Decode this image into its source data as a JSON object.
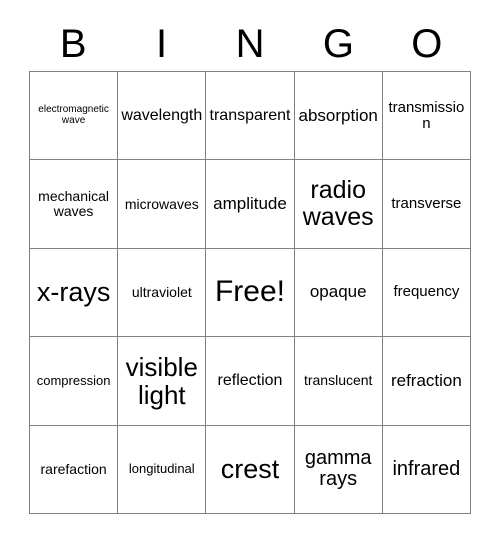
{
  "card": {
    "title_letters": [
      "B",
      "I",
      "N",
      "G",
      "O"
    ],
    "rows": [
      [
        {
          "text": "electromagnetic wave",
          "size": "fs-10"
        },
        {
          "text": "wavelength",
          "size": "fs-16"
        },
        {
          "text": "transparent",
          "size": "fs-16"
        },
        {
          "text": "absorption",
          "size": "fs-17"
        },
        {
          "text": "transmission",
          "size": "fs-15"
        }
      ],
      [
        {
          "text": "mechanical waves",
          "size": "fs-14"
        },
        {
          "text": "microwaves",
          "size": "fs-14"
        },
        {
          "text": "amplitude",
          "size": "fs-17"
        },
        {
          "text": "radio waves",
          "size": "fs-25"
        },
        {
          "text": "transverse",
          "size": "fs-15"
        }
      ],
      [
        {
          "text": "x-rays",
          "size": "fs-27"
        },
        {
          "text": "ultraviolet",
          "size": "fs-14"
        },
        {
          "text": "Free!",
          "size": "fs-30"
        },
        {
          "text": "opaque",
          "size": "fs-17"
        },
        {
          "text": "frequency",
          "size": "fs-15"
        }
      ],
      [
        {
          "text": "compression",
          "size": "fs-13"
        },
        {
          "text": "visible light",
          "size": "fs-26"
        },
        {
          "text": "reflection",
          "size": "fs-16"
        },
        {
          "text": "translucent",
          "size": "fs-14"
        },
        {
          "text": "refraction",
          "size": "fs-17"
        }
      ],
      [
        {
          "text": "rarefaction",
          "size": "fs-14"
        },
        {
          "text": "longitudinal",
          "size": "fs-13"
        },
        {
          "text": "crest",
          "size": "fs-27"
        },
        {
          "text": "gamma rays",
          "size": "fs-20"
        },
        {
          "text": "infrared",
          "size": "fs-20"
        }
      ]
    ],
    "colors": {
      "background": "#ffffff",
      "grid_line": "#808080",
      "text": "#000000"
    }
  }
}
